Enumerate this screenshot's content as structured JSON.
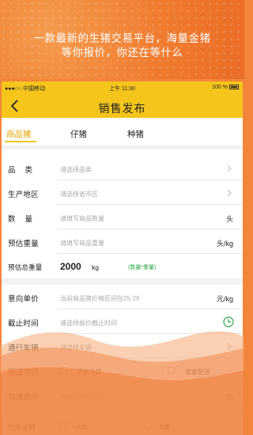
{
  "promo": {
    "line1": "一款最新的生猪交易平台，海量金猪",
    "line2": "等你报价，你还在等什么"
  },
  "status_bar": {
    "carrier": "●●●○○ 中国移动 ",
    "time": "上午 11:30",
    "battery": "100 %"
  },
  "nav": {
    "title": "销售发布"
  },
  "tabs": [
    {
      "label": "商品猪",
      "active": true
    },
    {
      "label": "仔猪",
      "active": false
    },
    {
      "label": "种猪",
      "active": false
    }
  ],
  "form": {
    "category": {
      "label": "品类",
      "placeholder": "请选择品类"
    },
    "region": {
      "label": "生产地区",
      "placeholder": "请选择省市区"
    },
    "quantity": {
      "label": "数量",
      "placeholder": "请填写商品数量",
      "unit": "头"
    },
    "est_weight": {
      "label": "预估重量",
      "placeholder": "请填写商品重量",
      "unit": "头/kg"
    },
    "est_total": {
      "label": "预估总重量",
      "value": "2000",
      "unit": "kg",
      "hint": "(数量*重量)"
    },
    "unit_price": {
      "label": "意向单价",
      "placeholder": "当前商品猪价格区间在25-29",
      "unit": "元/kg"
    },
    "deadline": {
      "label": "截止时间",
      "placeholder": "请选择报价截止时间"
    },
    "vehicle": {
      "label": "通行车辆",
      "placeholder": "请选择车辆"
    },
    "delivery": {
      "label": "配送方式",
      "option1": "买家自提",
      "option2": "卖家配送"
    },
    "freight": {
      "label": "物流费用",
      "placeholder": "请填写物流费用",
      "unit": "元"
    },
    "inspection": {
      "label": "检疫证明",
      "option1": "A类",
      "option2": "B类"
    }
  },
  "colors": {
    "accent": "#f5c51c",
    "tab_active": "#e8a400",
    "promo_bg": "#ef7a2e",
    "hint_green": "#2aa84a"
  }
}
